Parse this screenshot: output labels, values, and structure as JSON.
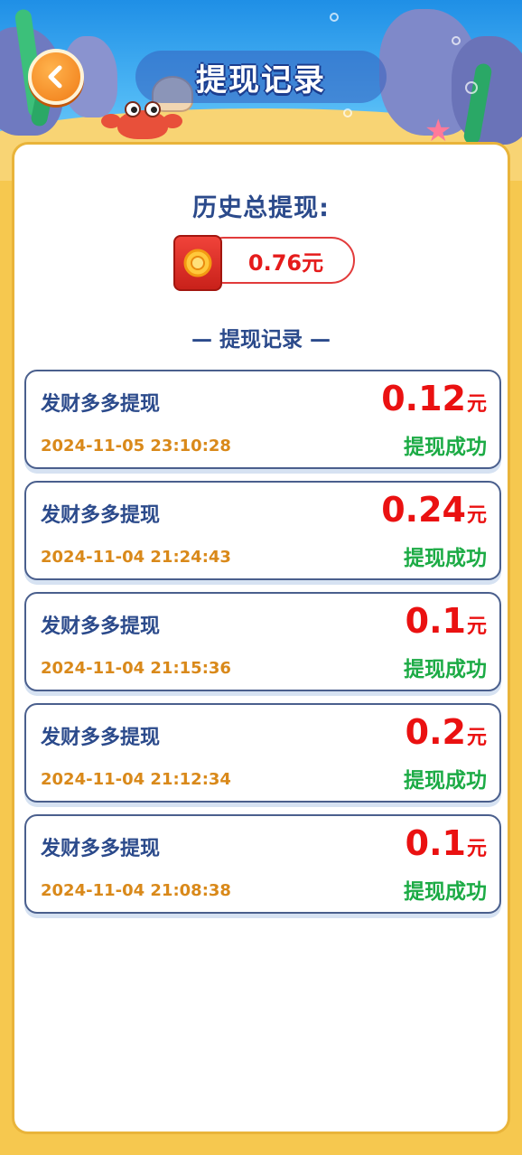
{
  "header": {
    "title": "提现记录",
    "back_icon": "chevron-left-icon"
  },
  "summary": {
    "label": "历史总提现:",
    "total": "0.76元",
    "icon": "red-packet-icon"
  },
  "section_title": "— 提现记录 —",
  "records": [
    {
      "name": "发财多多提现",
      "time": "2024-11-05 23:10:28",
      "amount": "0.12",
      "unit": "元",
      "status": "提现成功"
    },
    {
      "name": "发财多多提现",
      "time": "2024-11-04 21:24:43",
      "amount": "0.24",
      "unit": "元",
      "status": "提现成功"
    },
    {
      "name": "发财多多提现",
      "time": "2024-11-04 21:15:36",
      "amount": "0.1",
      "unit": "元",
      "status": "提现成功"
    },
    {
      "name": "发财多多提现",
      "time": "2024-11-04 21:12:34",
      "amount": "0.2",
      "unit": "元",
      "status": "提现成功"
    },
    {
      "name": "发财多多提现",
      "time": "2024-11-04 21:08:38",
      "amount": "0.1",
      "unit": "元",
      "status": "提现成功"
    }
  ],
  "colors": {
    "accent_red": "#ea1111",
    "success_green": "#1cab45",
    "time_orange": "#d9891a",
    "title_blue": "#2b4a8b",
    "frame_gold": "#f6c84f"
  }
}
